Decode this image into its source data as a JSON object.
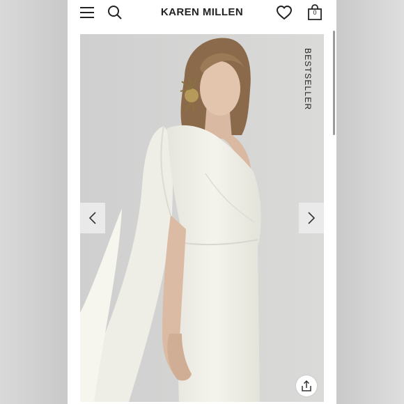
{
  "header": {
    "brand": "KAREN MILLEN",
    "bag_count": "0",
    "menu_icon": "hamburger-menu-icon",
    "search_icon": "search-icon",
    "wishlist_icon": "heart-icon",
    "bag_icon": "shopping-bag-icon"
  },
  "gallery": {
    "badge": "BESTSELLER",
    "prev_icon": "chevron-left-icon",
    "next_icon": "chevron-right-icon",
    "share_icon": "share-icon",
    "image": "model-white-one-shoulder-cape-dress"
  },
  "colors": {
    "background": "#ffffff",
    "text": "#222222",
    "image_bg": "#d3d3d2",
    "dress": "#f2f1ea"
  }
}
